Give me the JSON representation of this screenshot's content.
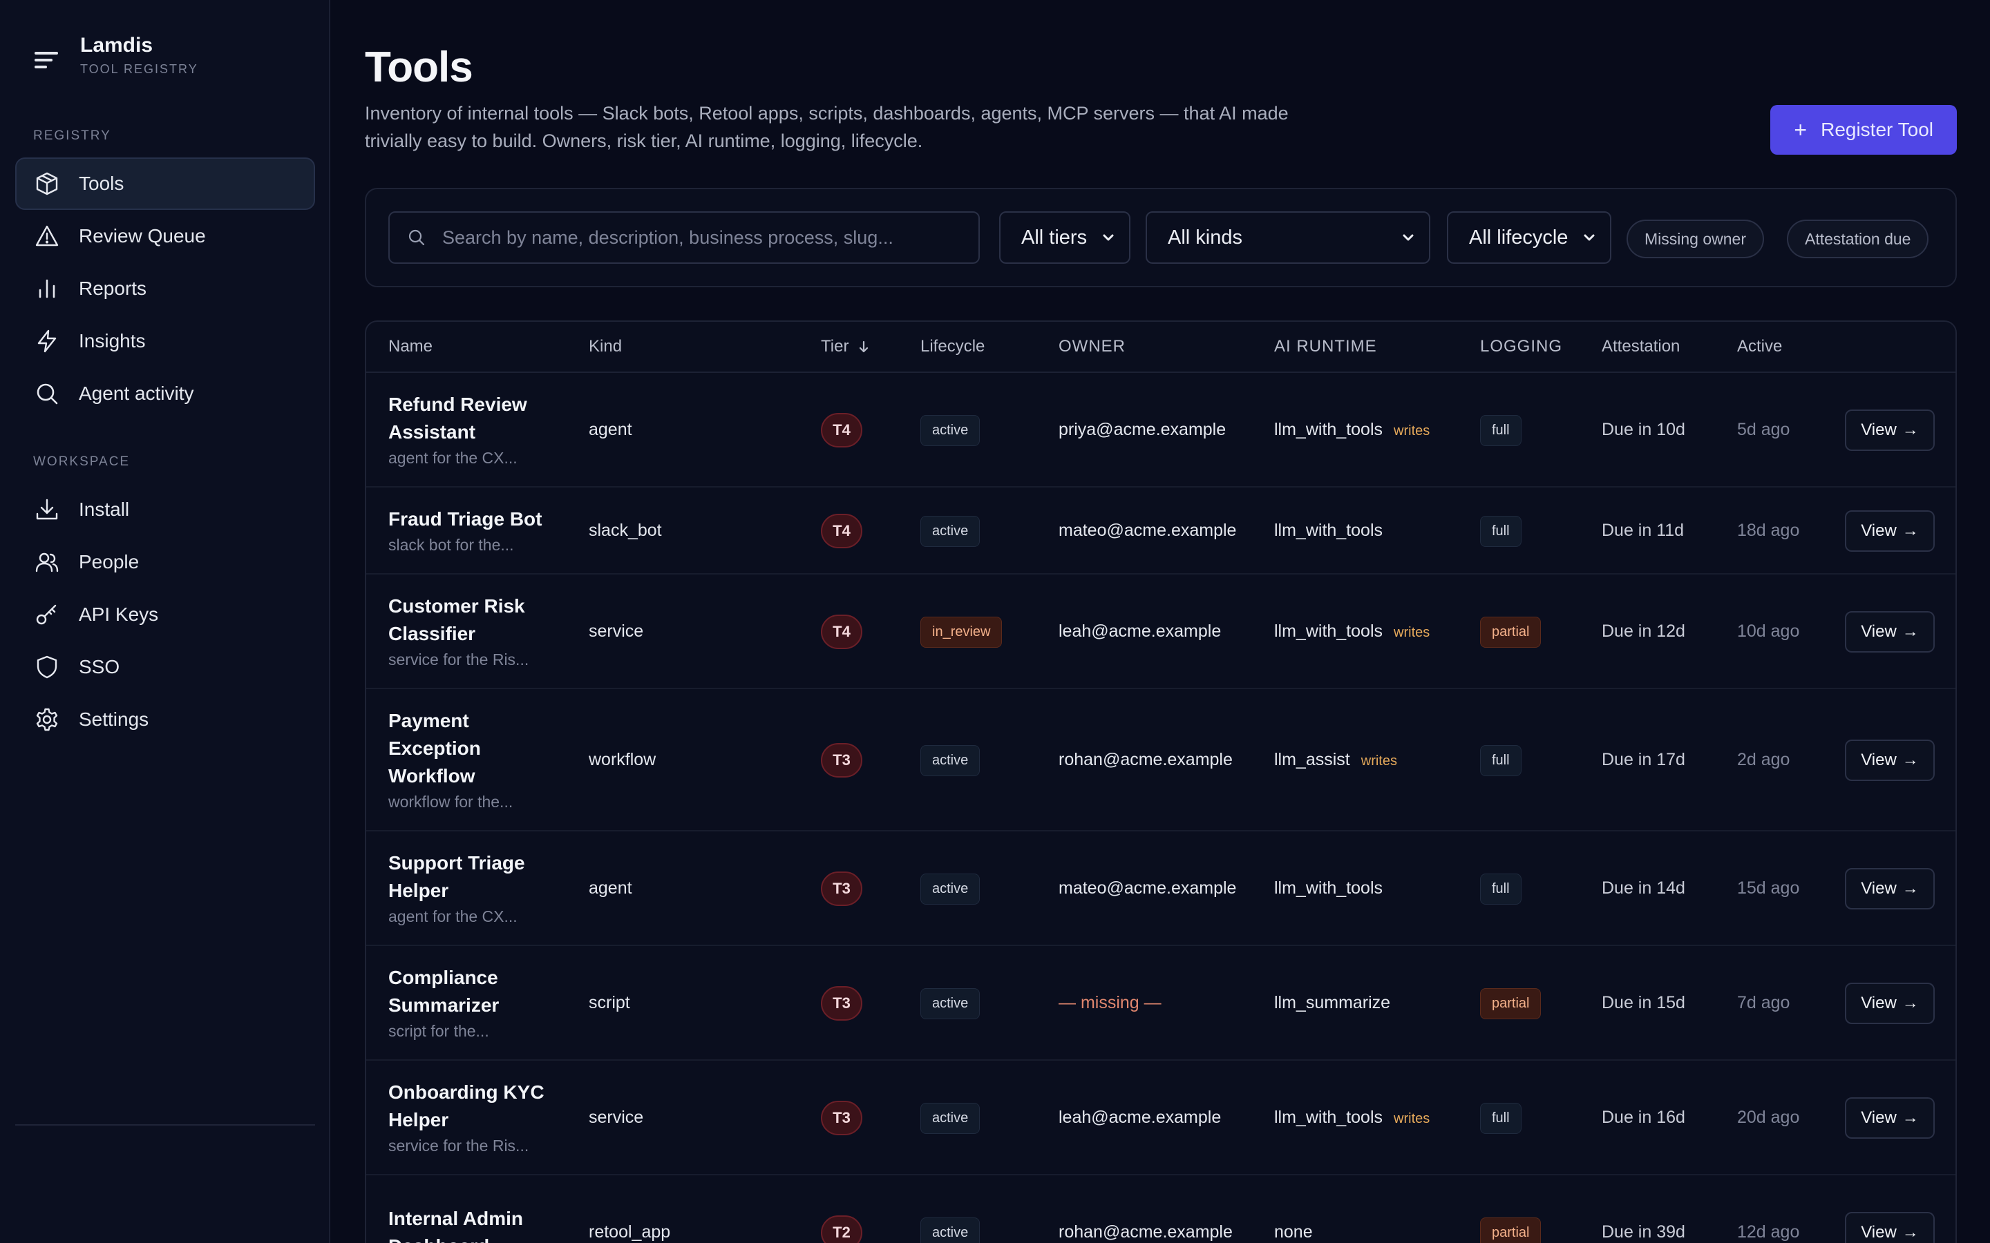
{
  "app": {
    "name": "Lamdis",
    "subtitle": "TOOL REGISTRY"
  },
  "sidebar": {
    "registry_label": "REGISTRY",
    "workspace_label": "WORKSPACE",
    "registry_items": [
      {
        "label": "Tools",
        "icon": "cube-icon",
        "active": true
      },
      {
        "label": "Review Queue",
        "icon": "warning-icon"
      },
      {
        "label": "Reports",
        "icon": "bar-chart-icon"
      },
      {
        "label": "Insights",
        "icon": "lightning-icon"
      },
      {
        "label": "Agent activity",
        "icon": "search-icon"
      }
    ],
    "workspace_items": [
      {
        "label": "Install",
        "icon": "download-icon"
      },
      {
        "label": "People",
        "icon": "people-icon"
      },
      {
        "label": "API Keys",
        "icon": "key-icon"
      },
      {
        "label": "SSO",
        "icon": "shield-icon"
      },
      {
        "label": "Settings",
        "icon": "gear-icon"
      }
    ]
  },
  "header": {
    "title": "Tools",
    "description": "Inventory of internal tools — Slack bots, Retool apps, scripts, dashboards, agents, MCP servers — that AI made trivially easy to build. Owners, risk tier, AI runtime, logging, lifecycle.",
    "register_label": "Register Tool"
  },
  "filters": {
    "search_placeholder": "Search by name, description, business process, slug...",
    "tier": "All tiers",
    "kind": "All kinds",
    "lifecycle": "All lifecycle",
    "pill_missing_owner": "Missing owner",
    "pill_attestation_due": "Attestation due"
  },
  "table": {
    "columns": {
      "name": "Name",
      "kind": "Kind",
      "tier": "Tier",
      "lifecycle": "Lifecycle",
      "owner": "OWNER",
      "runtime": "AI RUNTIME",
      "logging": "LOGGING",
      "attestation": "Attestation",
      "active": "Active"
    },
    "view_label": "View",
    "rows": [
      {
        "name_lines": [
          "Refund Review",
          "Assistant"
        ],
        "desc": "agent for the CX...",
        "kind": "agent",
        "tier": "T4",
        "lifecycle": "active",
        "owner": "priya@acme.example",
        "runtime": "llm_with_tools",
        "writes": "writes",
        "logging": "full",
        "attestation": "Due in 10d",
        "active": "5d ago"
      },
      {
        "name_lines": [
          "Fraud Triage Bot"
        ],
        "desc": "slack bot for the...",
        "kind": "slack_bot",
        "tier": "T4",
        "lifecycle": "active",
        "owner": "mateo@acme.example",
        "runtime": "llm_with_tools",
        "writes": "",
        "logging": "full",
        "attestation": "Due in 11d",
        "active": "18d ago"
      },
      {
        "name_lines": [
          "Customer Risk",
          "Classifier"
        ],
        "desc": "service for the Ris...",
        "kind": "service",
        "tier": "T4",
        "lifecycle": "in_review",
        "owner": "leah@acme.example",
        "runtime": "llm_with_tools",
        "writes": "writes",
        "logging": "partial",
        "attestation": "Due in 12d",
        "active": "10d ago"
      },
      {
        "name_lines": [
          "Payment",
          "Exception",
          "Workflow"
        ],
        "desc": "workflow for the...",
        "kind": "workflow",
        "tier": "T3",
        "lifecycle": "active",
        "owner": "rohan@acme.example",
        "runtime": "llm_assist",
        "writes": "writes",
        "logging": "full",
        "attestation": "Due in 17d",
        "active": "2d ago"
      },
      {
        "name_lines": [
          "Support Triage",
          "Helper"
        ],
        "desc": "agent for the CX...",
        "kind": "agent",
        "tier": "T3",
        "lifecycle": "active",
        "owner": "mateo@acme.example",
        "runtime": "llm_with_tools",
        "writes": "",
        "logging": "full",
        "attestation": "Due in 14d",
        "active": "15d ago"
      },
      {
        "name_lines": [
          "Compliance",
          "Summarizer"
        ],
        "desc": "script for the...",
        "kind": "script",
        "tier": "T3",
        "lifecycle": "active",
        "owner": "— missing —",
        "owner_missing": true,
        "runtime": "llm_summarize",
        "writes": "",
        "logging": "partial",
        "attestation": "Due in 15d",
        "active": "7d ago"
      },
      {
        "name_lines": [
          "Onboarding KYC",
          "Helper"
        ],
        "desc": "service for the Ris...",
        "kind": "service",
        "tier": "T3",
        "lifecycle": "active",
        "owner": "leah@acme.example",
        "runtime": "llm_with_tools",
        "writes": "writes",
        "logging": "full",
        "attestation": "Due in 16d",
        "active": "20d ago"
      },
      {
        "name_lines": [
          "Internal Admin",
          "Dashboard"
        ],
        "desc": "",
        "kind": "retool_app",
        "tier": "T2",
        "lifecycle": "active",
        "owner": "rohan@acme.example",
        "runtime": "none",
        "writes": "",
        "logging": "partial",
        "attestation": "Due in 39d",
        "active": "12d ago"
      }
    ]
  }
}
